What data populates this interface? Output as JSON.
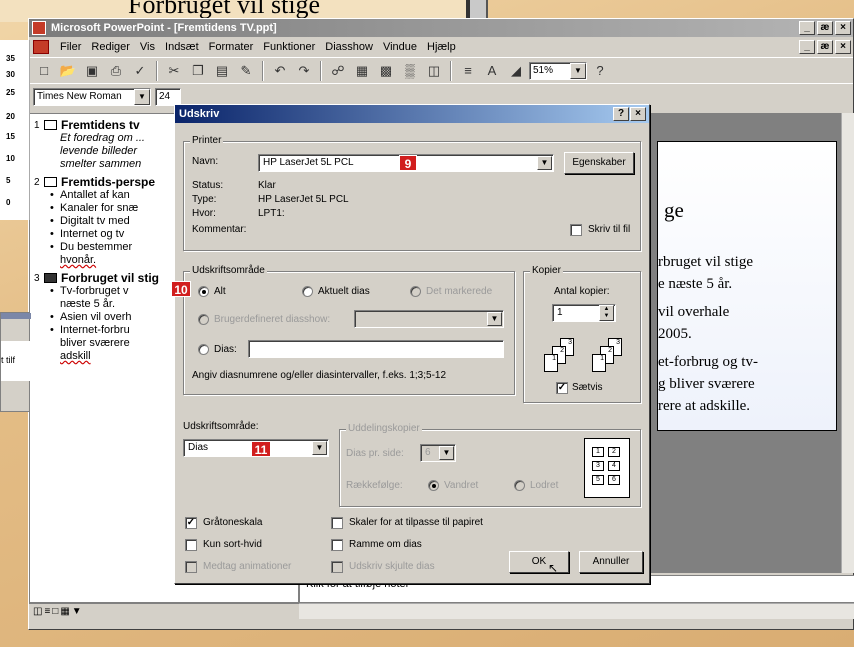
{
  "background": {
    "title": "Forbruget vil stige",
    "ruler_ticks": [
      "35",
      "30",
      "25",
      "20",
      "15",
      "10",
      "5",
      "0"
    ],
    "peek_text": "t tilf"
  },
  "window": {
    "title": "Microsoft PowerPoint - [Fremtidens TV.ppt]",
    "controls": [
      "_",
      "æ",
      "×"
    ]
  },
  "menubar": {
    "items": [
      "Filer",
      "Rediger",
      "Vis",
      "Indsæt",
      "Formater",
      "Funktioner",
      "Diasshow",
      "Vindue",
      "Hjælp"
    ],
    "doc_controls": [
      "_",
      "æ",
      "×"
    ]
  },
  "toolbar": {
    "zoom": "51%",
    "font_name": "Times New Roman",
    "font_size": "24"
  },
  "outline": {
    "slides": [
      {
        "num": "1",
        "title": "Fremtidens tv",
        "notes": [
          "Et foredrag om ...",
          "levende billeder",
          "smelter sammen"
        ]
      },
      {
        "num": "2",
        "title": "Fremtids-perspe",
        "bullets": [
          "Antallet af kan",
          "Kanaler for snæ",
          "Digitalt tv med",
          "Internet og tv",
          "Du bestemmer"
        ],
        "extra": "hvonår."
      },
      {
        "num": "3",
        "title": "Forbruget vil stig",
        "bullets": [
          "Tv-forbruget v",
          "Asien vil overh",
          "Internet-forbru"
        ],
        "sub": [
          "næste 5 år.",
          "bliver sværere",
          "adskill"
        ]
      }
    ]
  },
  "slide": {
    "title": "ge",
    "lines": [
      "rbruget vil stige",
      "e næste 5 år.",
      "vil overhale",
      "2005.",
      "et-forbrug og tv-",
      "g bliver sværere",
      "rere at adskille."
    ]
  },
  "notes": {
    "placeholder": "Klik for at tilføje noter"
  },
  "dialog": {
    "title": "Udskriv",
    "help": "?",
    "close": "×",
    "printer": {
      "group": "Printer",
      "name_label": "Navn:",
      "name_value": "HP LaserJet 5L PCL",
      "properties_button": "Egenskaber",
      "status_label": "Status:",
      "status_value": "Klar",
      "type_label": "Type:",
      "type_value": "HP LaserJet 5L PCL",
      "where_label": "Hvor:",
      "where_value": "LPT1:",
      "comment_label": "Kommentar:",
      "print_to_file": "Skriv til fil"
    },
    "range": {
      "group": "Udskriftsområde",
      "all": "Alt",
      "current": "Aktuelt dias",
      "selection": "Det markerede",
      "custom_show": "Brugerdefineret diasshow:",
      "slides": "Dias:",
      "hint": "Angiv diasnumrene og/eller diasintervaller, f.eks. 1;3;5-12"
    },
    "copies": {
      "group": "Kopier",
      "count_label": "Antal kopier:",
      "count_value": "1",
      "collate": "Sætvis",
      "page_numbers": [
        "1",
        "2",
        "3",
        "1",
        "2",
        "3"
      ]
    },
    "print_what": {
      "label": "Udskriftsområde:",
      "value": "Dias"
    },
    "handouts": {
      "group": "Uddelingskopier",
      "per_page_label": "Dias pr. side:",
      "per_page_value": "6",
      "order_label": "Rækkefølge:",
      "horizontal": "Vandret",
      "vertical": "Lodret",
      "grid": [
        "1",
        "2",
        "3",
        "4",
        "5",
        "6"
      ]
    },
    "options": {
      "grayscale": "Gråtoneskala",
      "pure_bw": "Kun sort-hvid",
      "animations": "Medtag animationer",
      "scale_to_fit": "Skaler for at tilpasse til papiret",
      "frame_slides": "Ramme om dias",
      "hidden_slides": "Udskriv skjulte dias"
    },
    "ok": "OK",
    "cancel": "Annuller",
    "markers": {
      "m9": "9",
      "m10": "10",
      "m11": "11"
    }
  },
  "colors": {
    "dialog_title_start": "#0a246a",
    "marker": "#d11e1e",
    "window_face": "#d4d0c8"
  }
}
